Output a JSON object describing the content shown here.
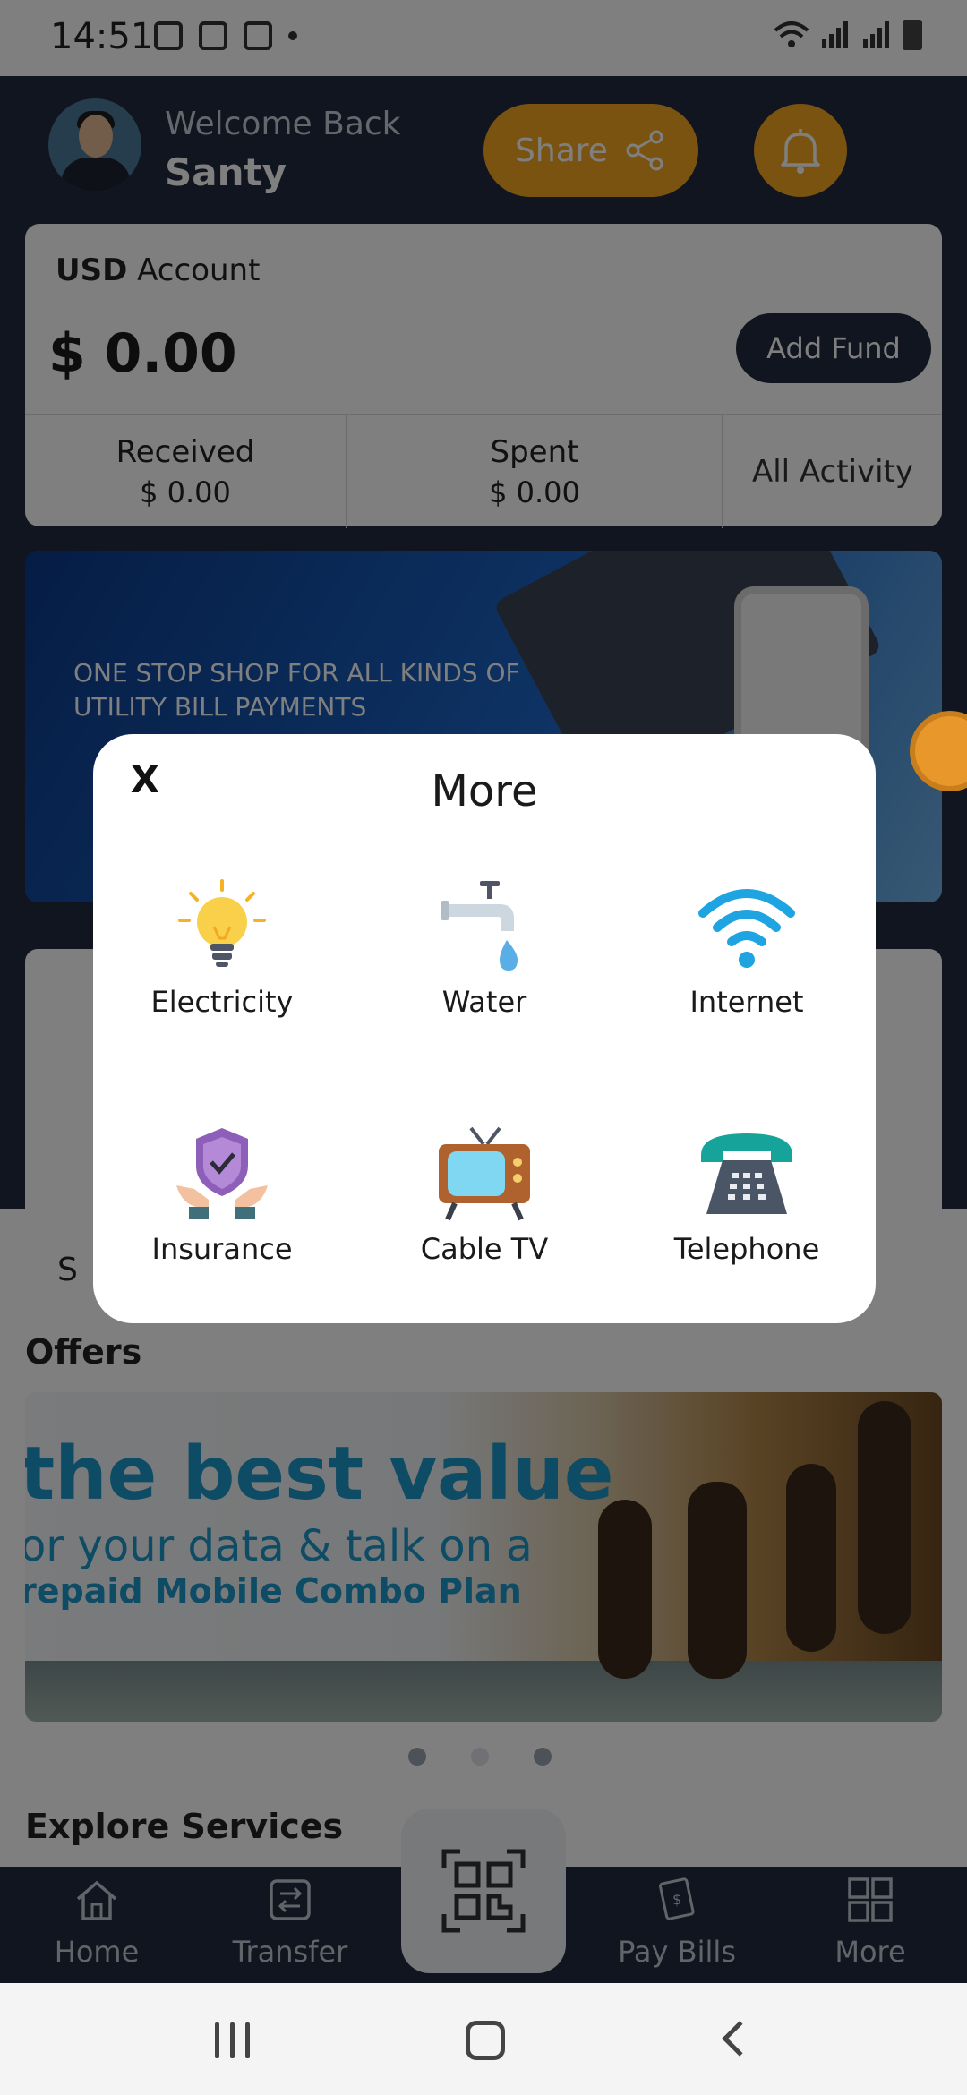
{
  "status_bar": {
    "time": "14:51"
  },
  "header": {
    "welcome": "Welcome Back",
    "username": "Santy",
    "share_label": "Share"
  },
  "account": {
    "currency": "USD",
    "account_word": "Account",
    "balance": "$ 0.00",
    "add_fund_label": "Add Fund",
    "received_label": "Received",
    "received_value": "$ 0.00",
    "spent_label": "Spent",
    "spent_value": "$ 0.00",
    "all_activity_label": "All Activity"
  },
  "promo": {
    "text": "ONE STOP SHOP FOR ALL KINDS OF UTILITY BILL PAYMENTS"
  },
  "services_partial": {
    "letter": "S"
  },
  "offers": {
    "title": "Offers",
    "banner_line1": "the best value",
    "banner_line2": "or your data & talk on a",
    "banner_line3": "repaid Mobile Combo Plan"
  },
  "carousel": {
    "count": 3,
    "active_index": 1
  },
  "explore": {
    "title": "Explore Services"
  },
  "bottom_nav": {
    "home": "Home",
    "transfer": "Transfer",
    "pay_bills": "Pay Bills",
    "more": "More"
  },
  "modal": {
    "close_label": "X",
    "title": "More",
    "items": [
      {
        "label": "Electricity",
        "icon": "lightbulb-icon"
      },
      {
        "label": "Water",
        "icon": "water-tap-icon"
      },
      {
        "label": "Internet",
        "icon": "wifi-icon"
      },
      {
        "label": "Insurance",
        "icon": "insurance-shield-icon"
      },
      {
        "label": "Cable TV",
        "icon": "tv-icon"
      },
      {
        "label": "Telephone",
        "icon": "telephone-icon"
      }
    ]
  },
  "colors": {
    "navy": "#232b3e",
    "accent_orange": "#f5a623",
    "offer_blue": "#1c97c9"
  }
}
